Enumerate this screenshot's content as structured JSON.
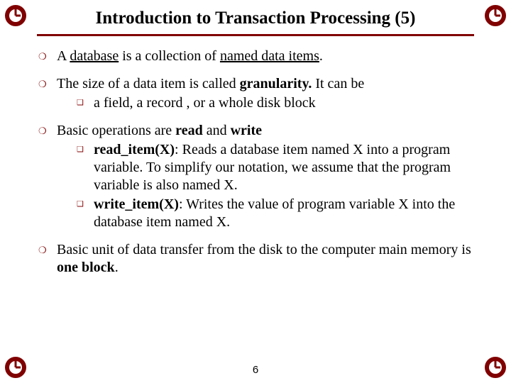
{
  "title": "Introduction to Transaction Processing (5)",
  "corner_icon_name": "clock-ring-icon",
  "page_number": "6",
  "bullets": {
    "b1_prefix": "A ",
    "b1_u1": "database",
    "b1_mid": " is a collection of ",
    "b1_u2": "named data items",
    "b1_suffix": ".",
    "b2_prefix": "The size of a data item is called ",
    "b2_bold": "granularity.",
    "b2_suffix": " It can be",
    "b2_sub1": " a field, a record , or a whole disk block",
    "b3_prefix": "Basic operations are ",
    "b3_b1": "read",
    "b3_mid": " and ",
    "b3_b2": "write",
    "b3_sub1_bold": "read_item(X)",
    "b3_sub1_rest": ": Reads a database item named X into a program variable. To simplify our notation, we assume that the program variable is also named X.",
    "b3_sub2_bold": "write_item(X)",
    "b3_sub2_rest": ": Writes the value of program variable X into the database item named X.",
    "b4_prefix": "Basic unit of data transfer from the disk to the computer main memory is ",
    "b4_bold": "one block",
    "b4_suffix": "."
  }
}
